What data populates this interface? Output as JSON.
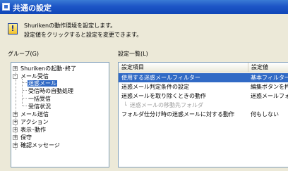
{
  "window": {
    "title": "共通の設定"
  },
  "info": {
    "line1": "Shurikenの動作環境を設定します。",
    "line2": "設定値をクリックすると設定を変更できます。"
  },
  "group_label": "グループ(G)",
  "list_label": "設定一覧(L)",
  "tree": {
    "items": [
      {
        "label": "Shurikenの起動･終了",
        "expander": "+"
      },
      {
        "label": "メール受信",
        "expander": "-"
      },
      {
        "label": "迷惑メール"
      },
      {
        "label": "受信時の自動処理"
      },
      {
        "label": "一括受信"
      },
      {
        "label": "受信状況"
      },
      {
        "label": "メール送信",
        "expander": "+"
      },
      {
        "label": "アクション",
        "expander": "+"
      },
      {
        "label": "表示･動作",
        "expander": "+"
      },
      {
        "label": "保守",
        "expander": "+"
      },
      {
        "label": "確認メッセージ",
        "expander": "+"
      }
    ]
  },
  "list": {
    "headers": [
      "設定項目",
      "設定値"
    ],
    "rows": [
      {
        "item": "使用する迷惑メールフィルター",
        "value": "基本フィルター"
      },
      {
        "item": "迷惑メール判定条件の設定",
        "value": "編集ボタンを押"
      },
      {
        "item": "迷惑メールを取り除くときの動作",
        "value": "迷惑メールフォ"
      },
      {
        "item": "迷惑メールの移動先フォルダ",
        "value": ""
      },
      {
        "item": "フォルダ仕分け時の迷惑メールに対する動作",
        "value": "何もしない"
      }
    ]
  }
}
